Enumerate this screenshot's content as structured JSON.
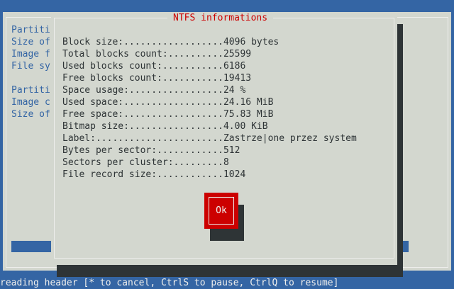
{
  "background_window": {
    "lines": [
      "Partiti",
      "Size of",
      "Image f",
      "File sy",
      "",
      "Partiti",
      "Image c",
      "Size of"
    ]
  },
  "dialog": {
    "title": "NTFS informations",
    "rows": [
      "Block size:..................4096 bytes",
      "Total blocks count:..........25599",
      "Used blocks count:...........6186",
      "Free blocks count:...........19413",
      "Space usage:.................24 %",
      "Used space:..................24.16 MiB",
      "Free space:..................75.83 MiB",
      "Bitmap size:.................4.00 KiB",
      "Label:.......................Zastrze|one przez system",
      "Bytes per sector:............512",
      "Sectors per cluster:.........8",
      "File record size:............1024"
    ],
    "ok_label": "Ok"
  },
  "status_bar": {
    "text": "reading header [* to cancel, CtrlS to pause, CtrlQ to resume]"
  },
  "colors": {
    "screen_blue": "#3465a4",
    "dialog_gray": "#d3d7cf",
    "title_red": "#cc0000",
    "button_red": "#cc0000",
    "shadow": "#2e3436"
  }
}
